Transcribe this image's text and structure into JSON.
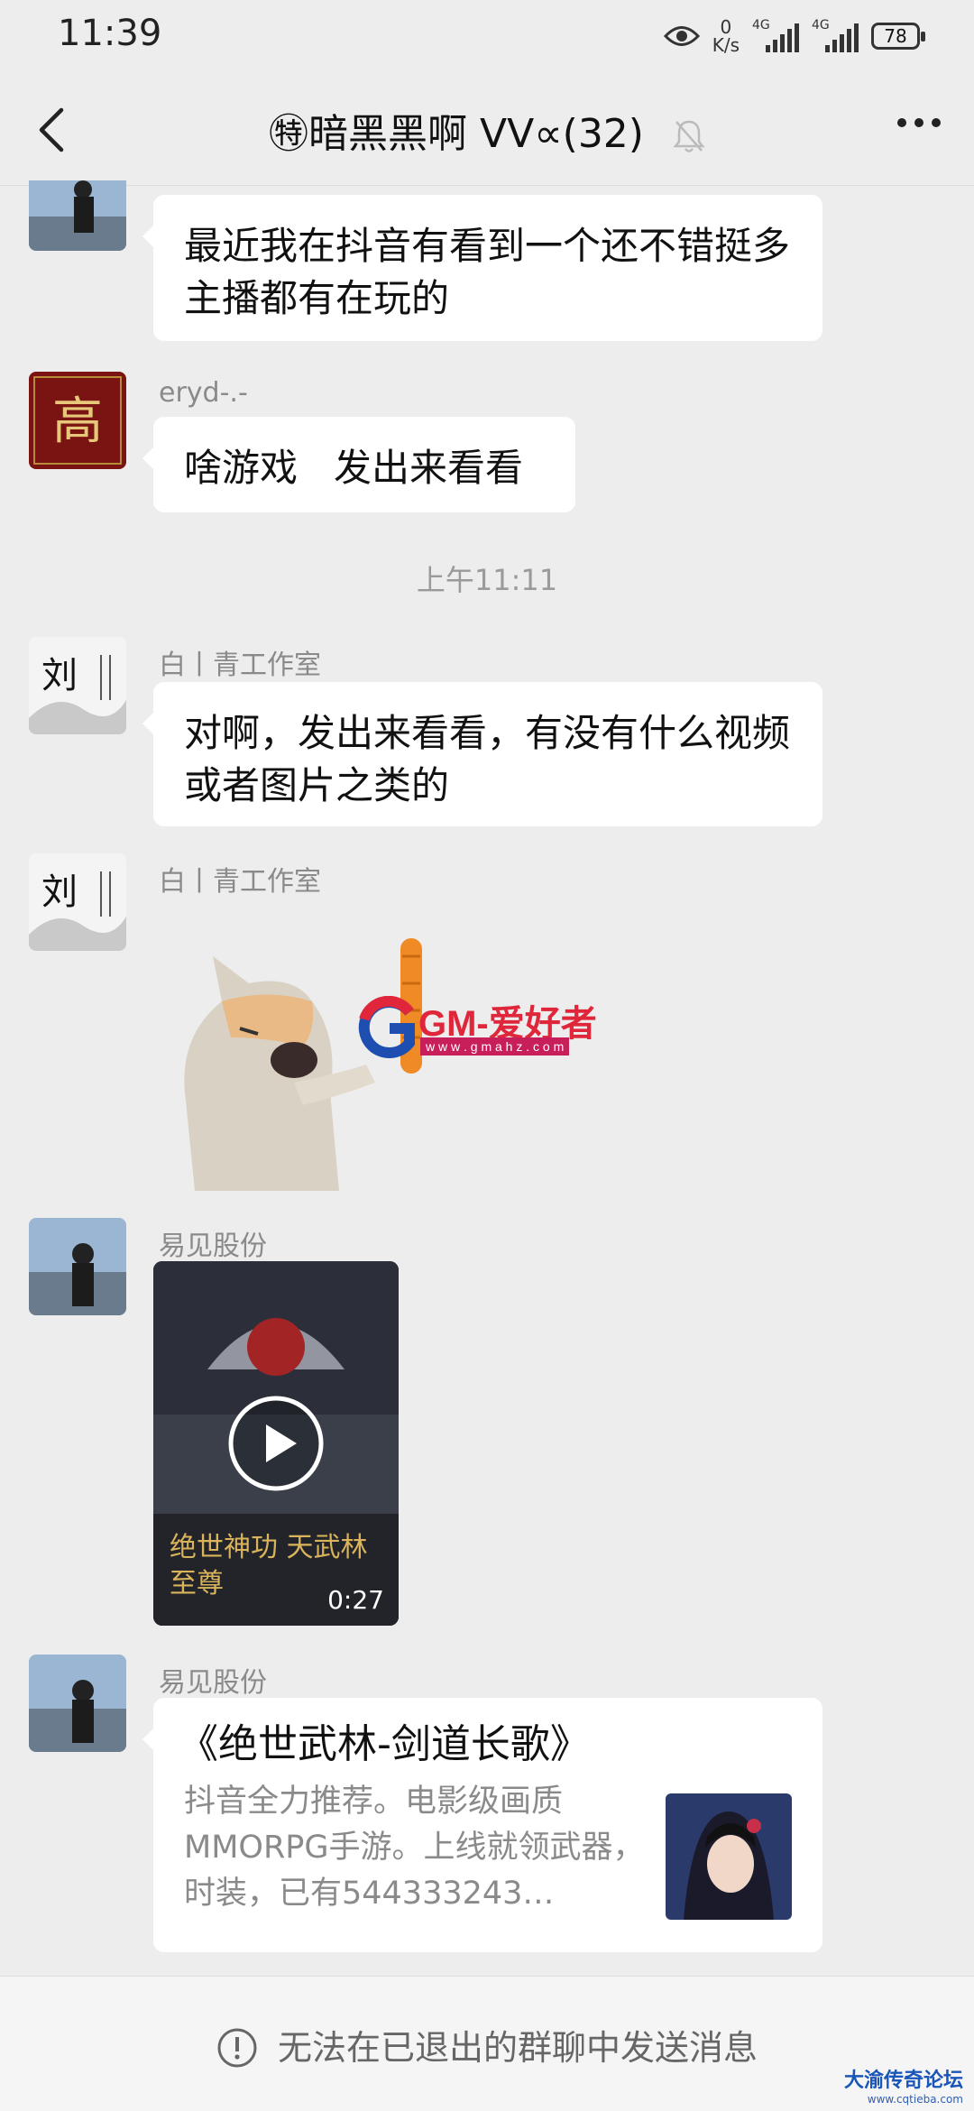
{
  "status_bar": {
    "time": "11:39",
    "net_speed_value": "0",
    "net_speed_unit": "K/s",
    "sim1_tag": "4G",
    "sim2_tag": "4G",
    "battery": "78"
  },
  "header": {
    "title": "㊕暗黑黑啊 VV∝(32)"
  },
  "messages": [
    {
      "text": "最近我在抖音有看到一个还不错挺多主播都有在玩的"
    },
    {
      "sender": "eryd-.-",
      "text": "啥游戏   发出来看看"
    },
    {
      "timestamp": "上午11:11"
    },
    {
      "sender": "白丨青工作室",
      "text": "对啊，发出来看看，有没有什么视频或者图片之类的"
    },
    {
      "sender": "白丨青工作室",
      "sticker_caption": "GM-爱好者",
      "sticker_url": "w w w . g m a h z . c o m"
    },
    {
      "sender": "易见股份",
      "video_caption": "绝世神功 天武林至尊",
      "video_duration": "0:27"
    },
    {
      "sender": "易见股份",
      "link_title": "《绝世武林-剑道长歌》",
      "link_desc": "抖音全力推荐。电影级画质MMORPG手游。上线就领武器，时装，已有544333243…"
    }
  ],
  "footer": {
    "notice": "无法在已退出的群聊中发送消息"
  },
  "watermark": {
    "line1": "大渝传奇论坛",
    "line2": "www.cqtieba.com"
  }
}
